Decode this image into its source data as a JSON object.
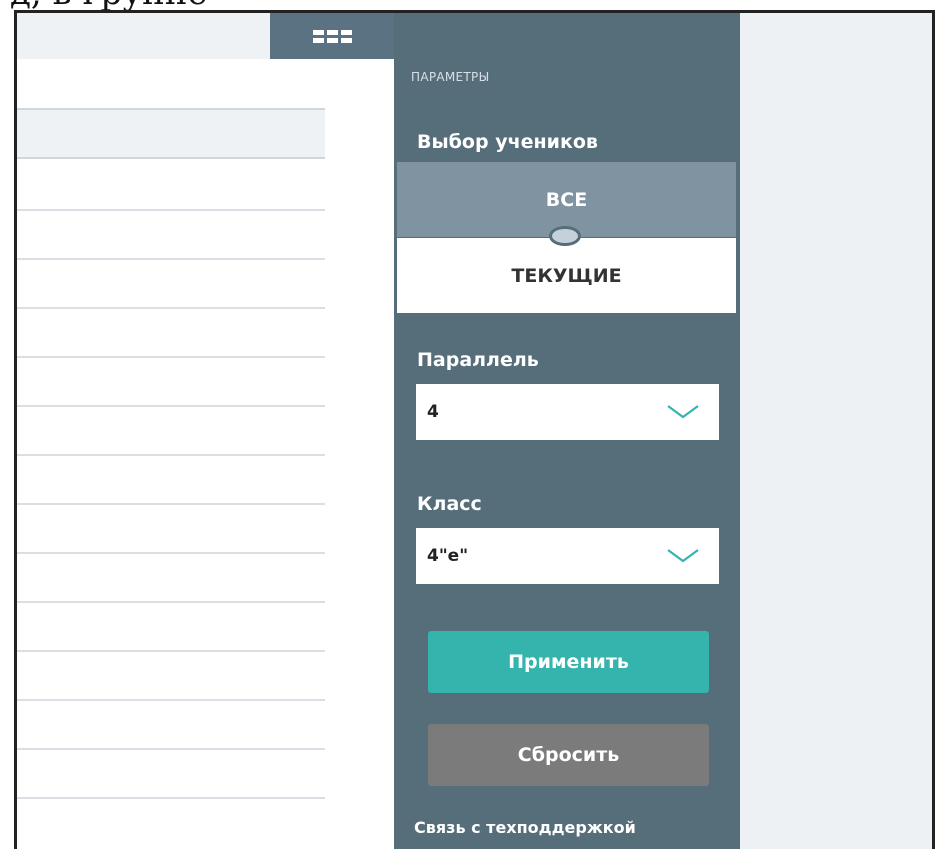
{
  "top_strip": {
    "clipped_text": "д, в группе"
  },
  "content": {
    "row_count": 13
  },
  "sidebar": {
    "section_label": "ПАРАМЕТРЫ",
    "student_select": {
      "title": "Выбор учеников",
      "option_all": "ВСЕ",
      "option_current": "ТЕКУЩИЕ",
      "selected": "ТЕКУЩИЕ"
    },
    "parallel": {
      "label": "Параллель",
      "value": "4"
    },
    "class": {
      "label": "Класс",
      "value": "4\"е\""
    },
    "apply_button": "Применить",
    "reset_button": "Сбросить",
    "support_link": "Связь с техподдержкой"
  },
  "colors": {
    "sidebar_bg": "#566d7a",
    "toggle_inactive": "#7f93a1",
    "apply_bg": "#35b3ad",
    "reset_bg": "#7b7b7b",
    "chevron": "#35b3ad"
  },
  "icons": {
    "menu": "grid-menu-icon",
    "dropdown": "chevron-down-icon"
  }
}
